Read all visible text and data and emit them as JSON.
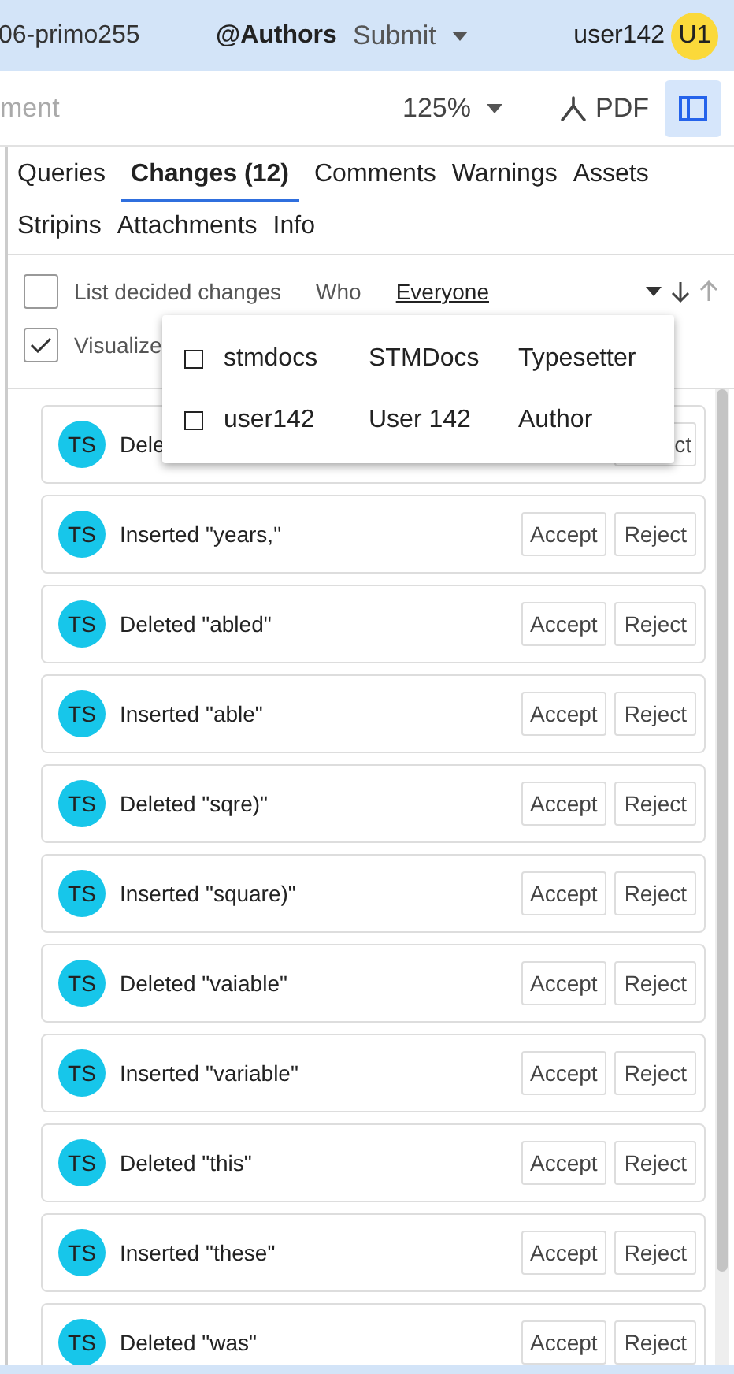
{
  "header": {
    "project": "06-primo255",
    "group": "@Authors",
    "submit": "Submit",
    "user": "user142",
    "avatar": "U1"
  },
  "toolbar": {
    "title": "ment",
    "zoom": "125%",
    "pdf": "PDF",
    "panel_on": true
  },
  "tabs": [
    {
      "label": "Queries",
      "selected": false
    },
    {
      "label": "Changes (12)",
      "selected": true
    },
    {
      "label": "Comments",
      "selected": false
    },
    {
      "label": "Warnings",
      "selected": false
    },
    {
      "label": "Assets",
      "selected": false
    },
    {
      "label": "Stripins",
      "selected": false
    },
    {
      "label": "Attachments",
      "selected": false
    },
    {
      "label": "Info",
      "selected": false
    }
  ],
  "filters": {
    "list_decided": {
      "label": "List decided changes",
      "checked": false
    },
    "who_label": "Who",
    "who_value": "Everyone",
    "visualize": {
      "label": "Visualize",
      "checked": true
    }
  },
  "who_menu": [
    {
      "login": "stmdocs",
      "name": "STMDocs",
      "role": "Typesetter",
      "checked": false
    },
    {
      "login": "user142",
      "name": "User 142",
      "role": "Author",
      "checked": false
    }
  ],
  "changes": [
    {
      "avatar": "TS",
      "text": "Dele",
      "reject": "ct"
    },
    {
      "avatar": "TS",
      "text": "Inserted \"years,\"",
      "accept": "Accept",
      "reject": "Reject"
    },
    {
      "avatar": "TS",
      "text": "Deleted \"abled\"",
      "accept": "Accept",
      "reject": "Reject"
    },
    {
      "avatar": "TS",
      "text": "Inserted \"able\"",
      "accept": "Accept",
      "reject": "Reject"
    },
    {
      "avatar": "TS",
      "text": "Deleted \"sqre)\"",
      "accept": "Accept",
      "reject": "Reject"
    },
    {
      "avatar": "TS",
      "text": "Inserted \"square)\"",
      "accept": "Accept",
      "reject": "Reject"
    },
    {
      "avatar": "TS",
      "text": "Deleted \"vaiable\"",
      "accept": "Accept",
      "reject": "Reject"
    },
    {
      "avatar": "TS",
      "text": "Inserted \"variable\"",
      "accept": "Accept",
      "reject": "Reject"
    },
    {
      "avatar": "TS",
      "text": "Deleted \"this\"",
      "accept": "Accept",
      "reject": "Reject"
    },
    {
      "avatar": "TS",
      "text": "Inserted \"these\"",
      "accept": "Accept",
      "reject": "Reject"
    },
    {
      "avatar": "TS",
      "text": "Deleted \"was\"",
      "accept": "Accept",
      "reject": "Reject"
    }
  ]
}
